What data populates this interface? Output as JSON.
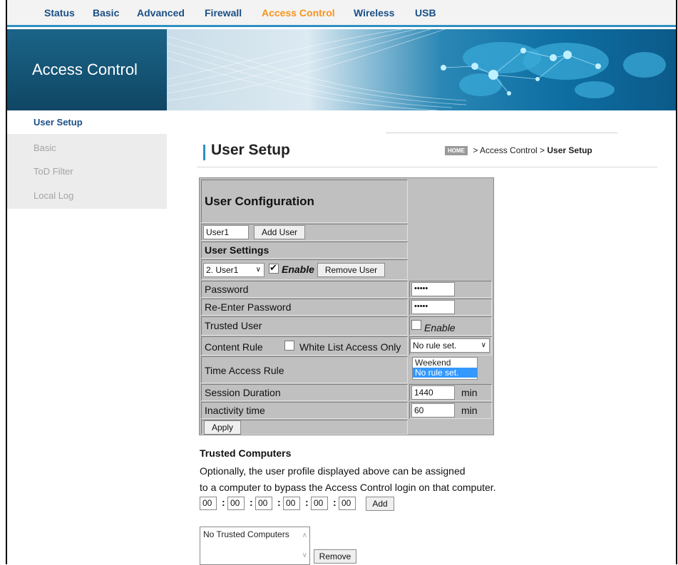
{
  "nav": {
    "items": [
      {
        "label": "Status"
      },
      {
        "label": "Basic"
      },
      {
        "label": "Advanced"
      },
      {
        "label": "Firewall"
      },
      {
        "label": "Access Control",
        "active": true
      },
      {
        "label": "Wireless"
      },
      {
        "label": "USB"
      }
    ]
  },
  "banner": {
    "title": "Access Control"
  },
  "sidebar": {
    "items": [
      {
        "label": "User Setup",
        "active": true
      },
      {
        "label": "Basic"
      },
      {
        "label": "ToD Filter"
      },
      {
        "label": "Local Log"
      }
    ]
  },
  "page": {
    "title": "User Setup",
    "breadcrumb": {
      "home": "HOME",
      "path": " > Access Control > ",
      "current": "User Setup"
    }
  },
  "config": {
    "heading": "User Configuration",
    "new_user_value": "User1",
    "add_user_label": "Add User",
    "settings_heading": "User Settings",
    "selected_user": "2. User1",
    "enable_label": "Enable",
    "enable_checked": true,
    "remove_user_label": "Remove User",
    "password_label": "Password",
    "password_value": "•••••",
    "reenter_label": "Re-Enter Password",
    "reenter_value": "•••••",
    "trusted_user_label": "Trusted User",
    "trusted_enable_label": "Enable",
    "trusted_checked": false,
    "content_rule_label": "Content Rule",
    "white_list_label": "White List Access Only",
    "white_list_checked": false,
    "content_rule_value": "No rule set.",
    "time_access_label": "Time Access Rule",
    "time_access_options": [
      "Weekend",
      "No rule set."
    ],
    "time_access_selected": "No rule set.",
    "session_label": "Session Duration",
    "session_value": "1440",
    "session_unit": "min",
    "inactivity_label": "Inactivity time",
    "inactivity_value": "60",
    "inactivity_unit": "min",
    "apply_label": "Apply"
  },
  "trusted": {
    "title": "Trusted Computers",
    "line1": "Optionally, the user profile displayed above can be assigned",
    "line2": "to a computer to bypass the Access Control login on that computer.",
    "mac": [
      "00",
      "00",
      "00",
      "00",
      "00",
      "00"
    ],
    "add_label": "Add",
    "list_text": "No Trusted Computers",
    "remove_label": "Remove"
  },
  "colors": {
    "accent_orange": "#f7941d",
    "nav_blue": "#1b4f86",
    "banner_dark": "#0f4664",
    "selection": "#3399ff"
  }
}
